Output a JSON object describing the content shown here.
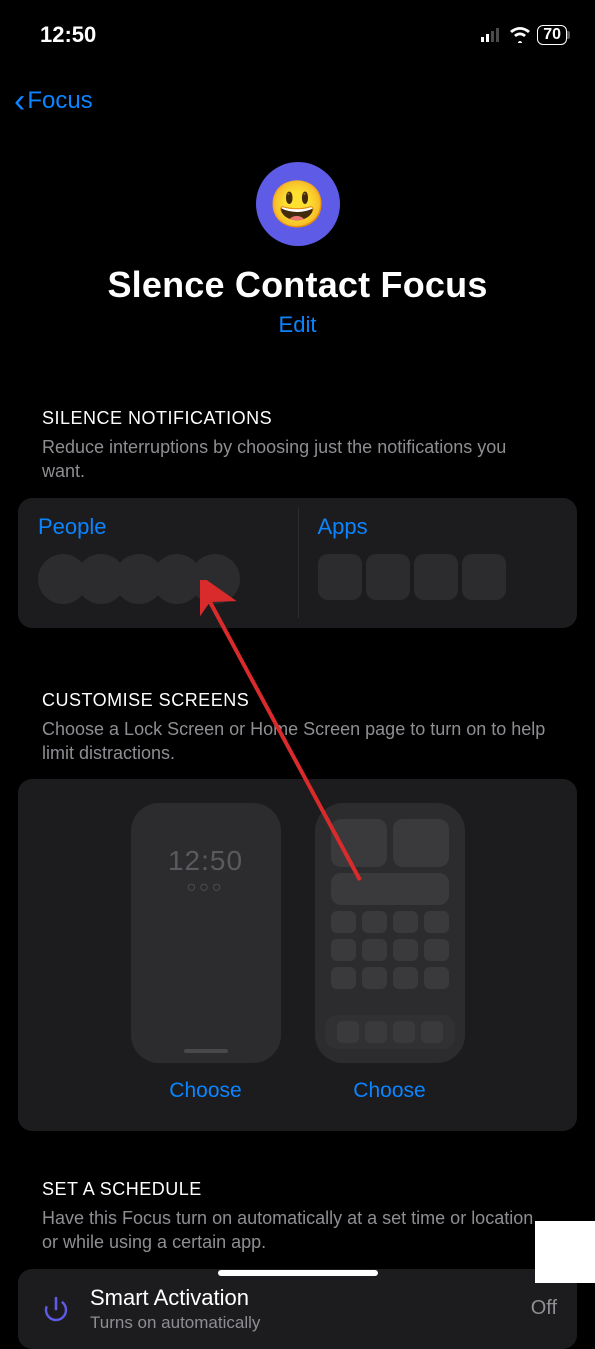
{
  "status": {
    "time": "12:50",
    "battery": "70"
  },
  "nav": {
    "back": "Focus"
  },
  "hero": {
    "emoji": "😃",
    "title": "Slence Contact Focus",
    "edit": "Edit"
  },
  "silence": {
    "header": "SILENCE NOTIFICATIONS",
    "desc": "Reduce interruptions by choosing just the notifications you want.",
    "people": "People",
    "apps": "Apps"
  },
  "screens": {
    "header": "CUSTOMISE SCREENS",
    "desc": "Choose a Lock Screen or Home Screen page to turn on to help limit distractions.",
    "lock_time": "12:50",
    "lock_dots": "○○○",
    "choose": "Choose"
  },
  "schedule": {
    "header": "SET A SCHEDULE",
    "desc": "Have this Focus turn on automatically at a set time or location, or while using a certain app.",
    "row_title": "Smart Activation",
    "row_sub": "Turns on automatically",
    "row_val": "Off"
  }
}
